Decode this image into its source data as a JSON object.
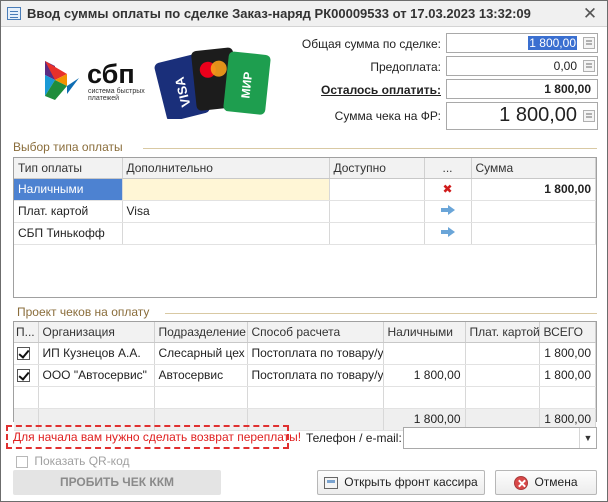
{
  "window": {
    "title": "Ввод суммы оплаты по сделке Заказ-наряд РК00009533 от 17.03.2023 13:32:09",
    "close_glyph": "✕"
  },
  "logos": {
    "sbp_title": "сбп",
    "sbp_subtitle": "система быстрых платежей"
  },
  "summary": {
    "total_label": "Общая сумма по сделке:",
    "total_value": "1 800,00",
    "prepay_label": "Предоплата:",
    "prepay_value": "0,00",
    "remain_label": "Осталось оплатить:",
    "remain_value": "1 800,00",
    "receipt_label": "Сумма чека на ФР:",
    "receipt_value": "1 800,00"
  },
  "payment_section": {
    "title": "Выбор типа оплаты",
    "columns": [
      "Тип оплаты",
      "Дополнительно",
      "Доступно",
      "...",
      "Сумма"
    ],
    "rows": [
      {
        "type": "Наличными",
        "extra": "",
        "available": "",
        "action": "delete",
        "sum": "1 800,00"
      },
      {
        "type": "Плат. картой",
        "extra": "Visa",
        "available": "",
        "action": "arrow",
        "sum": ""
      },
      {
        "type": "СБП Тинькофф",
        "extra": "",
        "available": "",
        "action": "arrow",
        "sum": ""
      }
    ]
  },
  "receipts_section": {
    "title": "Проект чеков на оплату",
    "columns": [
      "П...",
      "Организация",
      "Подразделение",
      "Способ расчета",
      "Наличными",
      "Плат. картой",
      "ВСЕГО"
    ],
    "rows": [
      {
        "checked": true,
        "org": "ИП Кузнецов А.А.",
        "dept": "Слесарный цех",
        "method": "Постоплата по товару/у...",
        "cash": "",
        "card": "",
        "total": "1 800,00"
      },
      {
        "checked": true,
        "org": "ООО \"Автосервис\"",
        "dept": "Автосервис",
        "method": "Постоплата по товару/у...",
        "cash": "1 800,00",
        "card": "",
        "total": "1 800,00"
      }
    ],
    "totals": {
      "cash": "1 800,00",
      "card": "",
      "total": "1 800,00"
    }
  },
  "bottom": {
    "warning": "Для начала вам нужно сделать возврат переплаты!",
    "phone_label": "Телефон / e-mail:",
    "phone_value": "",
    "qr_label": "Показать QR-код",
    "print_button": "ПРОБИТЬ ЧЕК ККМ",
    "front_button": "Открыть фронт кассира",
    "cancel_button": "Отмена"
  },
  "colors": {
    "accent_blue": "#4d82d1",
    "section_title": "#8a6d3b",
    "warning_red": "#e02020"
  }
}
